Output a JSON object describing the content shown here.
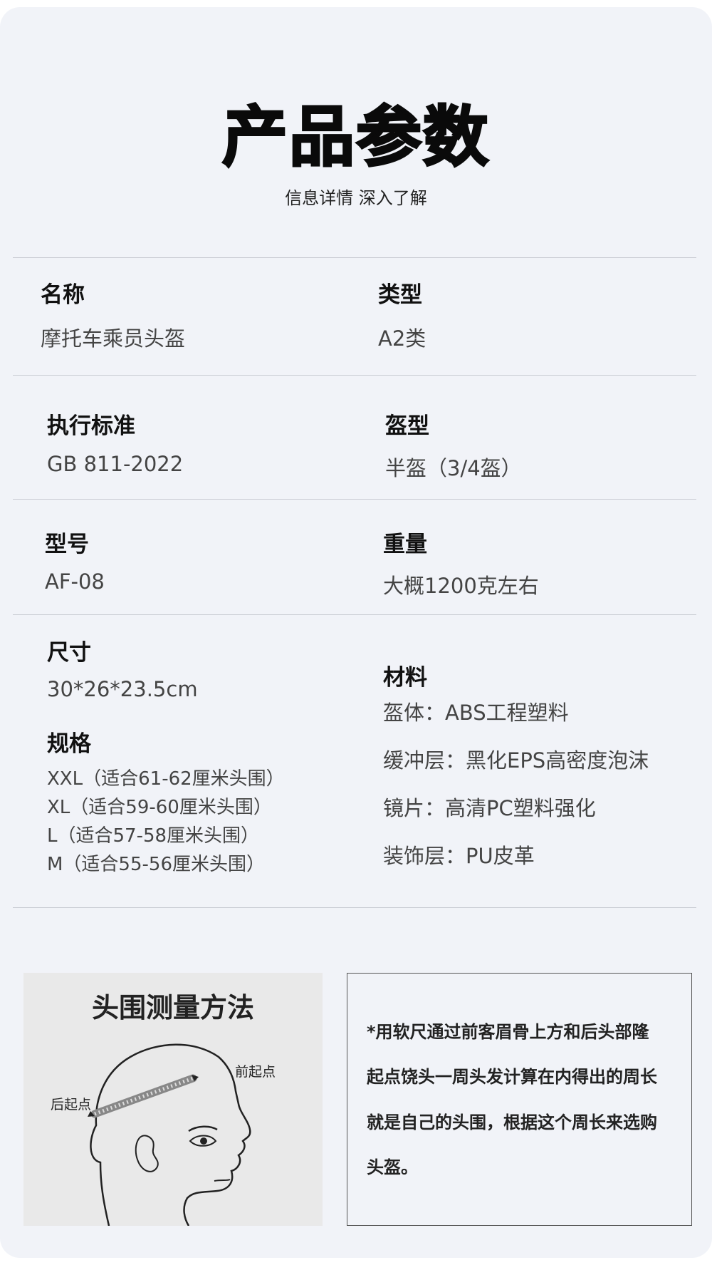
{
  "header": {
    "title": "产品参数",
    "subtitle": "信息详情  深入了解"
  },
  "params": {
    "name_label": "名称",
    "name_value": "摩托车乘员头盔",
    "type_label": "类型",
    "type_value": "A2类",
    "standard_label": "执行标准",
    "standard_value": "GB 811-2022",
    "helmet_type_label": "盔型",
    "helmet_type_value": "半盔（3/4盔）",
    "model_label": "型号",
    "model_value": "AF-08",
    "weight_label": "重量",
    "weight_value": "大概1200克左右",
    "dimension_label": "尺寸",
    "dimension_value": "30*26*23.5cm",
    "spec_label": "规格",
    "spec_items": [
      "XXL（适合61-62厘米头围）",
      "XL（适合59-60厘米头围）",
      "L（适合57-58厘米头围）",
      "M（适合55-56厘米头围）"
    ],
    "material_label": "材料",
    "material_items": [
      "盔体：ABS工程塑料",
      "缓冲层：黑化EPS高密度泡沫",
      "镜片：高清PC塑料强化",
      "装饰层：PU皮革"
    ]
  },
  "guide": {
    "title": "头围测量方法",
    "front_point": "前起点",
    "back_point": "后起点"
  },
  "note": {
    "lines": [
      "*用软尺通过前客眉骨上方和后头部隆",
      "起点饶头一周头发计算在内得出的周长",
      "就是自己的头围，根据这个周长来选购",
      "头盔。"
    ]
  }
}
